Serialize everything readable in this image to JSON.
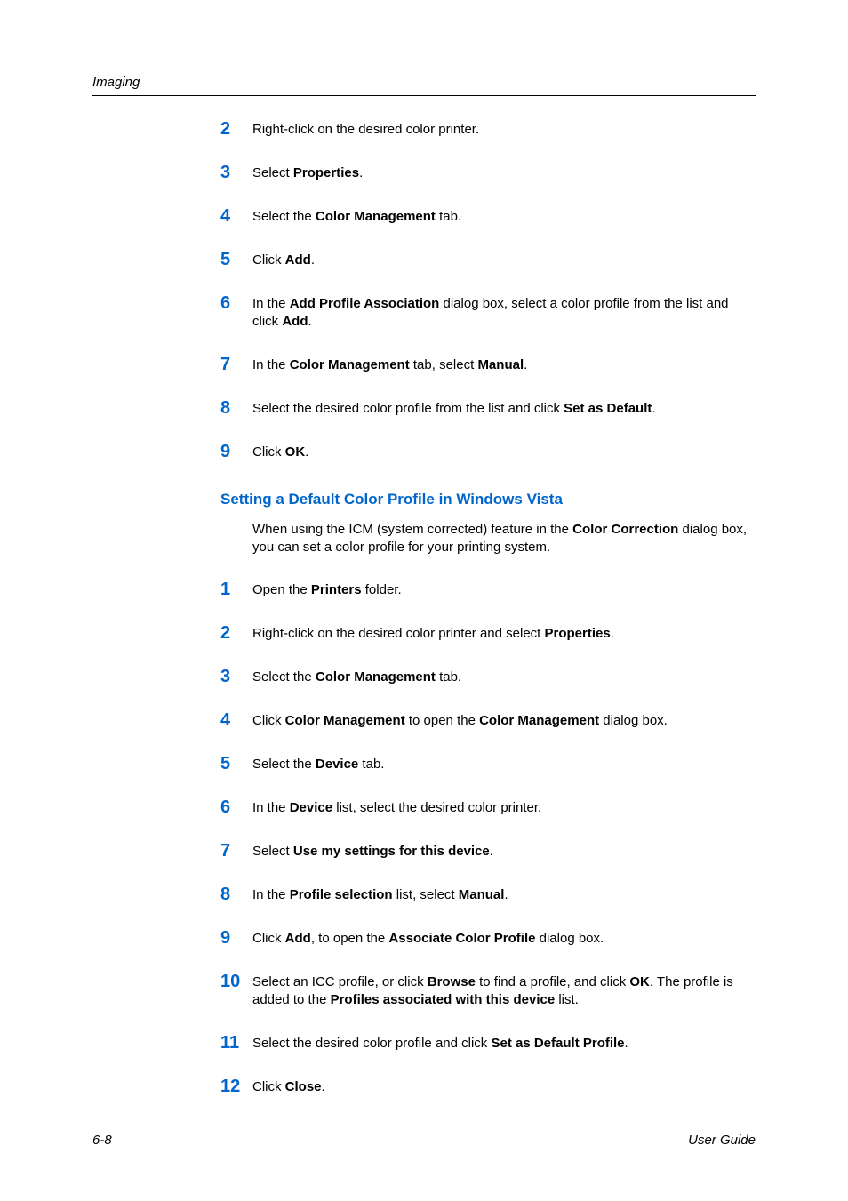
{
  "header": {
    "title": "Imaging"
  },
  "section1": {
    "steps": [
      {
        "n": "2",
        "parts": [
          "Right-click on the desired color printer."
        ]
      },
      {
        "n": "3",
        "parts": [
          "Select ",
          "Properties",
          "."
        ]
      },
      {
        "n": "4",
        "parts": [
          "Select the ",
          "Color Management",
          " tab."
        ]
      },
      {
        "n": "5",
        "parts": [
          "Click ",
          "Add",
          "."
        ]
      },
      {
        "n": "6",
        "parts": [
          "In the ",
          "Add Profile Association",
          " dialog box, select a color profile from the list and click ",
          "Add",
          "."
        ]
      },
      {
        "n": "7",
        "parts": [
          "In the ",
          "Color Management",
          " tab, select ",
          "Manual",
          "."
        ]
      },
      {
        "n": "8",
        "parts": [
          "Select the desired color profile from the list and click ",
          "Set as Default",
          "."
        ]
      },
      {
        "n": "9",
        "parts": [
          "Click ",
          "OK",
          "."
        ]
      }
    ]
  },
  "section2": {
    "heading": "Setting a Default Color Profile in Windows Vista",
    "intro_parts": [
      "When using the ICM (system corrected) feature in the ",
      "Color Correction",
      " dialog box, you can set a color profile for your printing system."
    ],
    "steps": [
      {
        "n": "1",
        "parts": [
          "Open the ",
          "Printers",
          " folder."
        ]
      },
      {
        "n": "2",
        "parts": [
          "Right-click on the desired color printer and select ",
          "Properties",
          "."
        ]
      },
      {
        "n": "3",
        "parts": [
          "Select the ",
          "Color Management",
          " tab."
        ]
      },
      {
        "n": "4",
        "parts": [
          "Click ",
          "Color Management",
          " to open the ",
          "Color Management",
          " dialog box."
        ]
      },
      {
        "n": "5",
        "parts": [
          "Select the ",
          "Device",
          " tab."
        ]
      },
      {
        "n": "6",
        "parts": [
          "In the ",
          "Device",
          " list, select the desired color printer."
        ]
      },
      {
        "n": "7",
        "parts": [
          "Select ",
          "Use my settings for this device",
          "."
        ]
      },
      {
        "n": "8",
        "parts": [
          "In the ",
          "Profile selection",
          " list, select ",
          "Manual",
          "."
        ]
      },
      {
        "n": "9",
        "parts": [
          "Click ",
          "Add",
          ", to open the ",
          "Associate Color Profile",
          " dialog box."
        ]
      },
      {
        "n": "10",
        "parts": [
          "Select an ICC profile, or click ",
          "Browse",
          " to find a profile, and click ",
          "OK",
          ". The profile is added to the ",
          "Profiles associated with this device",
          " list."
        ]
      },
      {
        "n": "11",
        "parts": [
          "Select the desired color profile and click ",
          "Set as Default Profile",
          "."
        ]
      },
      {
        "n": "12",
        "parts": [
          "Click ",
          "Close",
          "."
        ]
      }
    ]
  },
  "footer": {
    "page": "6-8",
    "label": "User Guide"
  }
}
